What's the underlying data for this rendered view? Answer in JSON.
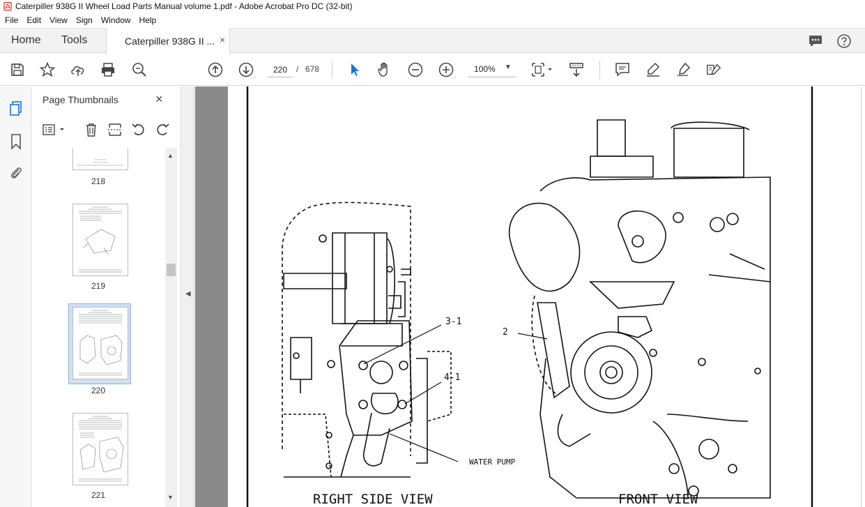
{
  "window": {
    "title": "Caterpiller 938G II Wheel Load  Parts Manual volume 1.pdf - Adobe Acrobat Pro DC (32-bit)"
  },
  "menu": {
    "items": [
      "File",
      "Edit",
      "View",
      "Sign",
      "Window",
      "Help"
    ]
  },
  "tabs": {
    "home": "Home",
    "tools": "Tools",
    "document": "Caterpiller 938G II ...",
    "close": "×"
  },
  "toolbar": {
    "current_page": "220",
    "separator": "/",
    "total_pages": "678",
    "zoom": "100%",
    "icons": [
      "save-icon",
      "star-icon",
      "upload-icon",
      "print-icon",
      "search-zoom-icon",
      "page-up-icon",
      "page-down-icon",
      "select-arrow-icon",
      "hand-icon",
      "zoom-out-icon",
      "zoom-in-icon",
      "fit-page-icon",
      "scroll-mode-icon",
      "comment-icon",
      "highlight-pen-icon",
      "sign-icon",
      "edit-pdf-icon"
    ]
  },
  "sidebar": {
    "title": "Page Thumbnails",
    "close": "×",
    "thumbnails": [
      {
        "page": "218"
      },
      {
        "page": "219"
      },
      {
        "page": "220",
        "selected": true
      },
      {
        "page": "221"
      }
    ]
  },
  "drawing": {
    "labels": {
      "callout_3_1": "3-1",
      "callout_4_1": "4-1",
      "callout_2": "2",
      "water_pump": "WATER PUMP",
      "right_side_view": "RIGHT SIDE VIEW",
      "front_view": "FRONT VIEW"
    }
  },
  "colors": {
    "accent_blue": "#1473e6",
    "selection": "#cfe0f3",
    "acrobat_red": "#e02020"
  }
}
